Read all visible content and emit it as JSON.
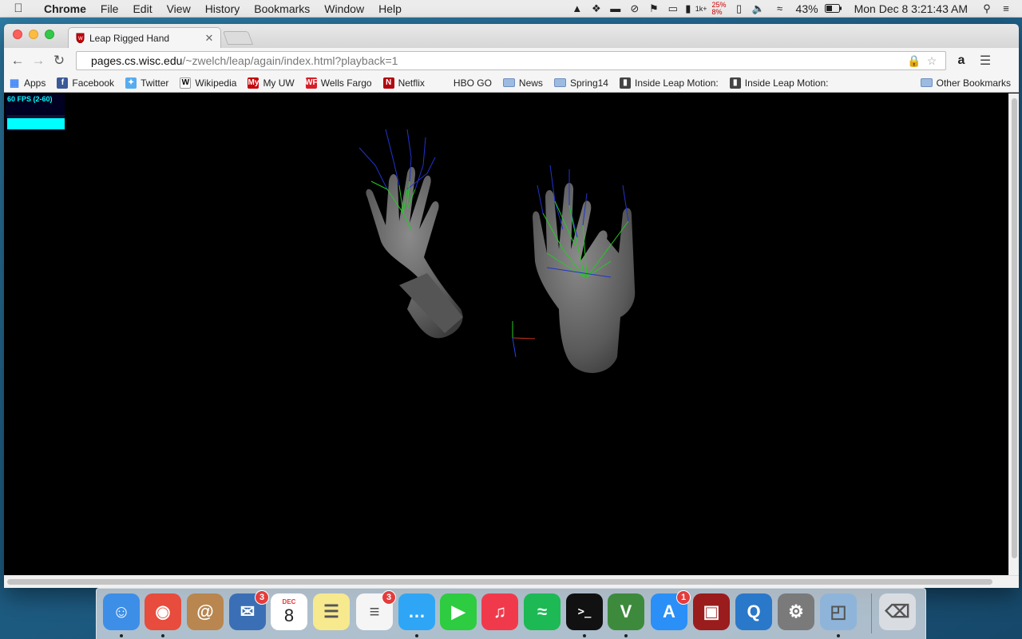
{
  "menubar": {
    "apple_icon": "apple-icon",
    "app_name": "Chrome",
    "menus": [
      "File",
      "Edit",
      "View",
      "History",
      "Bookmarks",
      "Window",
      "Help"
    ],
    "status_icons": [
      "google-drive-icon",
      "dropbox-icon",
      "battery-widget-icon",
      "timemachine-icon",
      "notification-icon",
      "airplay-icon",
      "memory-icon"
    ],
    "memory_label": "1k+",
    "cpu_top": "25%",
    "cpu_bottom": "8%",
    "battery_percent": "43%",
    "datetime": "Mon Dec 8   3:21:43 AM"
  },
  "tab": {
    "title": "Leap Rigged Hand"
  },
  "omnibox": {
    "host": "pages.cs.wisc.edu",
    "path": "/~zwelch/leap/again/index.html?playback=1"
  },
  "bookmarks": [
    {
      "label": "Apps",
      "icon": "apps-grid-icon",
      "color": "#4285f4"
    },
    {
      "label": "Facebook",
      "icon": "facebook-icon",
      "color": "#3b5998"
    },
    {
      "label": "Twitter",
      "icon": "twitter-icon",
      "color": "#55acee"
    },
    {
      "label": "Wikipedia",
      "icon": "wikipedia-icon",
      "color": "#ffffff"
    },
    {
      "label": "My UW",
      "icon": "myuw-icon",
      "color": "#c5050c"
    },
    {
      "label": "Wells Fargo",
      "icon": "wellsfargo-icon",
      "color": "#d71e28"
    },
    {
      "label": "Netflix",
      "icon": "netflix-icon",
      "color": "#b20710"
    },
    {
      "label": "HBO GO",
      "icon": "",
      "color": ""
    },
    {
      "label": "News",
      "icon": "folder-icon",
      "color": "#7fa6d6"
    },
    {
      "label": "Spring14",
      "icon": "folder-icon",
      "color": "#7fa6d6"
    },
    {
      "label": "Inside Leap Motion: ",
      "icon": "leap-icon",
      "color": "#444444"
    },
    {
      "label": "Inside Leap Motion: ",
      "icon": "leap-icon",
      "color": "#444444"
    }
  ],
  "other_bookmarks": "Other Bookmarks",
  "stats": {
    "fps_text": "60 FPS (2-60)",
    "color": "#00ffff"
  },
  "dock": [
    {
      "name": "finder",
      "color": "#3d8ee6"
    },
    {
      "name": "chrome",
      "color": "#e74c3c"
    },
    {
      "name": "contacts",
      "color": "#b8864e"
    },
    {
      "name": "thunderbird",
      "color": "#3a6fb5",
      "badge": "3"
    },
    {
      "name": "calendar",
      "color": "#ffffff",
      "month": "DEC",
      "day": "8"
    },
    {
      "name": "notes",
      "color": "#f7e98e"
    },
    {
      "name": "reminders",
      "color": "#f5f5f5",
      "badge": "3"
    },
    {
      "name": "messages",
      "color": "#2ea6f5"
    },
    {
      "name": "facetime",
      "color": "#2ecc40"
    },
    {
      "name": "itunes",
      "color": "#f03a4b"
    },
    {
      "name": "spotify",
      "color": "#1db954"
    },
    {
      "name": "terminal",
      "color": "#111111"
    },
    {
      "name": "vim",
      "color": "#3d8a3d"
    },
    {
      "name": "app-store",
      "color": "#2a8ff7",
      "badge": "1"
    },
    {
      "name": "photo-booth",
      "color": "#9b1c1c"
    },
    {
      "name": "quicktime",
      "color": "#2a78c9"
    },
    {
      "name": "system-preferences",
      "color": "#7a7a7a"
    },
    {
      "name": "preview",
      "color": "#8fb4d9"
    },
    {
      "name": "trash",
      "color": "#d9dde2"
    }
  ]
}
